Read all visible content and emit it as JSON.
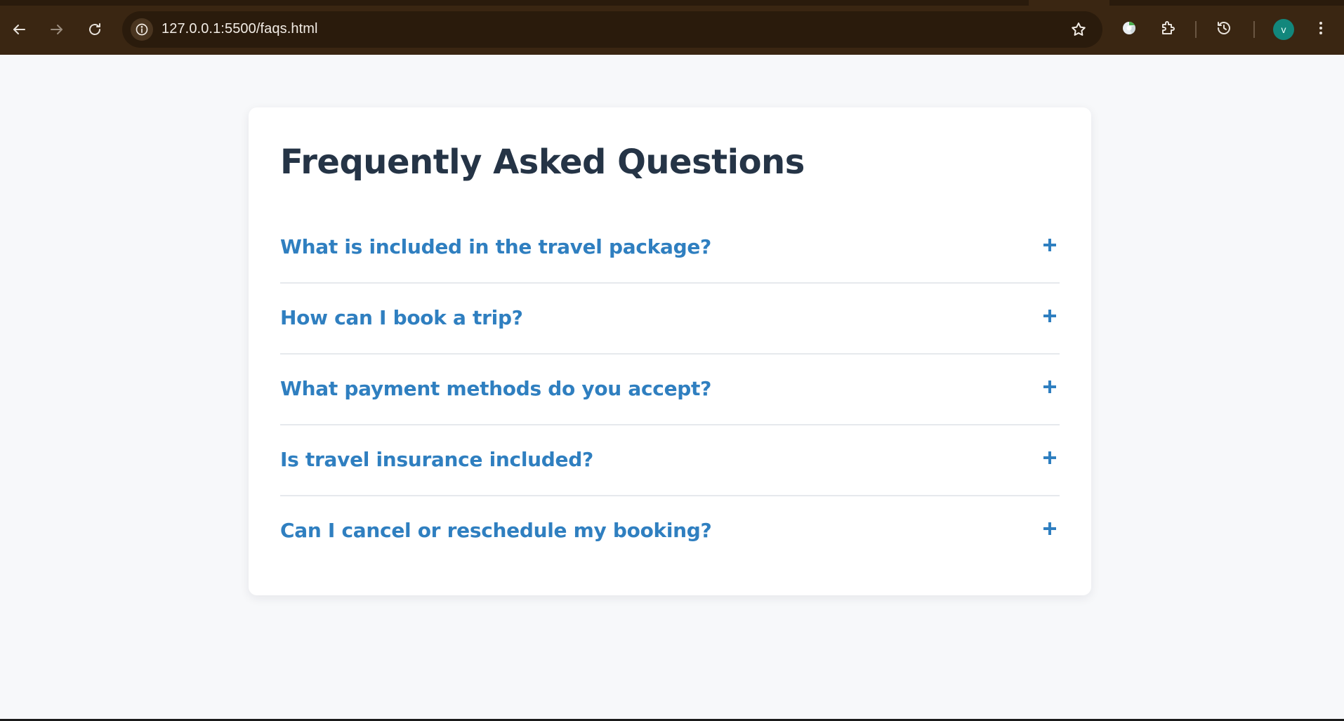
{
  "browser": {
    "url": "127.0.0.1:5500/faqs.html",
    "profile_initial": "v",
    "accent_color": "#12877c",
    "toolbar_color": "#3a2612"
  },
  "page": {
    "title": "Frequently Asked Questions",
    "question_color": "#2f7fc0",
    "title_color": "#253446"
  },
  "faqs": [
    {
      "question": "What is included in the travel package?",
      "icon": "plus-icon"
    },
    {
      "question": "How can I book a trip?",
      "icon": "plus-icon"
    },
    {
      "question": "What payment methods do you accept?",
      "icon": "plus-icon"
    },
    {
      "question": "Is travel insurance included?",
      "icon": "plus-icon"
    },
    {
      "question": "Can I cancel or reschedule my booking?",
      "icon": "plus-icon"
    }
  ]
}
